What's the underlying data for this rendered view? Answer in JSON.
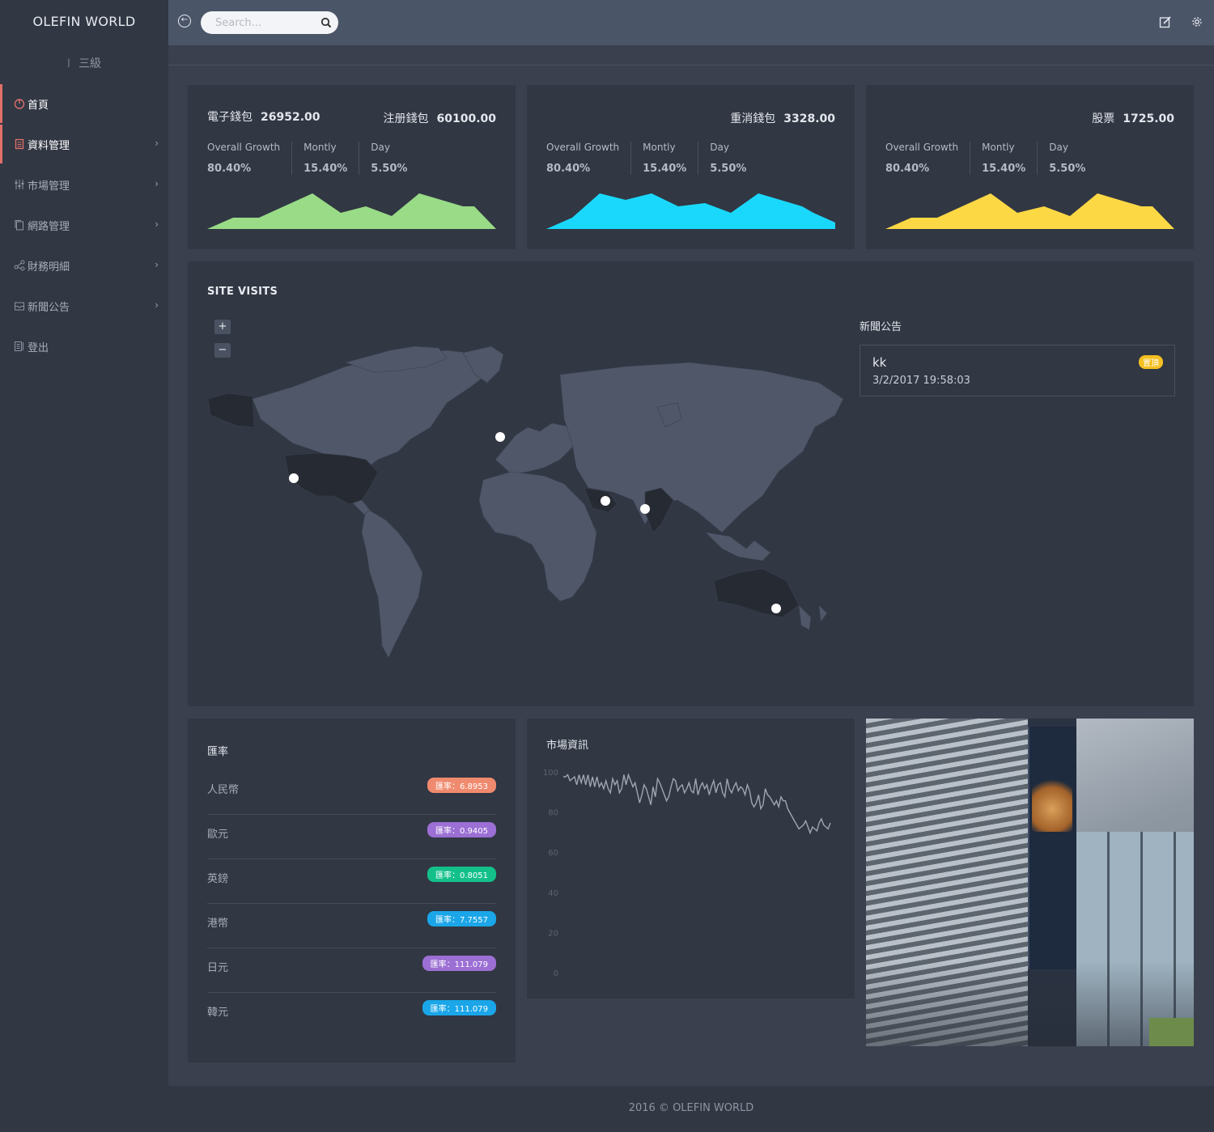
{
  "brand": "OLEFIN WORLD",
  "level": {
    "bar": "I",
    "label": "三級"
  },
  "sidebar": {
    "items": [
      {
        "label": "首頁",
        "icon": "power-icon"
      },
      {
        "label": "資料管理",
        "icon": "document-icon"
      },
      {
        "label": "市場管理",
        "icon": "sliders-icon"
      },
      {
        "label": "網路管理",
        "icon": "copy-icon"
      },
      {
        "label": "財務明細",
        "icon": "share-icon"
      },
      {
        "label": "新聞公告",
        "icon": "inbox-icon"
      },
      {
        "label": "登出",
        "icon": "list-icon"
      }
    ]
  },
  "topbar": {
    "search_placeholder": "Search...",
    "back_icon": "back-arrow-icon",
    "search_icon": "search-icon",
    "edit_icon": "edit-icon",
    "settings_icon": "gear-icon"
  },
  "stats": [
    {
      "items": [
        {
          "label": "電子錢包",
          "value": "26952.00"
        },
        {
          "label": "注册錢包",
          "value": "60100.00"
        }
      ],
      "metrics": [
        {
          "label": "Overall Growth",
          "value": "80.40%"
        },
        {
          "label": "Montly",
          "value": "15.40%"
        },
        {
          "label": "Day",
          "value": "5.50%"
        }
      ],
      "color": "#99db86"
    },
    {
      "items": [
        {
          "label": "重消錢包",
          "value": "3328.00"
        }
      ],
      "metrics": [
        {
          "label": "Overall Growth",
          "value": "80.40%"
        },
        {
          "label": "Montly",
          "value": "15.40%"
        },
        {
          "label": "Day",
          "value": "5.50%"
        }
      ],
      "color": "#1ad8fb"
    },
    {
      "items": [
        {
          "label": "股票",
          "value": "1725.00"
        }
      ],
      "metrics": [
        {
          "label": "Overall Growth",
          "value": "80.40%"
        },
        {
          "label": "Montly",
          "value": "15.40%"
        },
        {
          "label": "Day",
          "value": "5.50%"
        }
      ],
      "color": "#fdd845"
    }
  ],
  "visits": {
    "title": "SITE VISITS",
    "zoom_in": "+",
    "zoom_out": "−"
  },
  "news": {
    "title": "新聞公告",
    "items": [
      {
        "headline": "kk",
        "date": "3/2/2017 19:58:03",
        "badge": "置頂"
      }
    ]
  },
  "rates": {
    "title": "匯率",
    "items": [
      {
        "currency": "人民幣",
        "rate": "匯率：6.8953",
        "color": "#f08a6e"
      },
      {
        "currency": "歐元",
        "rate": "匯率：0.9405",
        "color": "#9b6fd4"
      },
      {
        "currency": "英鎊",
        "rate": "匯率：0.8051",
        "color": "#13c08a"
      },
      {
        "currency": "港幣",
        "rate": "匯率：7.7557",
        "color": "#1aa6e8"
      },
      {
        "currency": "日元",
        "rate": "匯率：111.079",
        "color": "#9b6fd4"
      },
      {
        "currency": "韓元",
        "rate": "匯率：111.079",
        "color": "#1aa6e8"
      }
    ]
  },
  "market": {
    "title": "市場資訊"
  },
  "chart_data": {
    "type": "line",
    "title": "",
    "xlabel": "",
    "ylabel": "",
    "yticks": [
      0,
      20,
      40,
      60,
      80,
      100
    ],
    "ylim": [
      0,
      100
    ],
    "x": [
      0,
      1,
      2,
      3,
      4,
      5,
      6,
      7,
      8,
      9,
      10,
      11,
      12,
      13,
      14,
      15,
      16,
      17,
      18,
      19,
      20,
      21,
      22,
      23,
      24,
      25,
      26,
      27,
      28,
      29,
      30,
      31,
      32,
      33,
      34,
      35,
      36,
      37,
      38,
      39,
      40,
      41,
      42,
      43,
      44,
      45,
      46,
      47,
      48,
      49,
      50,
      51,
      52,
      53,
      54,
      55,
      56,
      57,
      58,
      59,
      60,
      61,
      62,
      63,
      64,
      65,
      66,
      67,
      68,
      69,
      70,
      71,
      72,
      73,
      74,
      75,
      76,
      77,
      78,
      79,
      80,
      81,
      82,
      83,
      84,
      85,
      86,
      87,
      88,
      89,
      90,
      91,
      92,
      93,
      94,
      95,
      96,
      97,
      98,
      99,
      100,
      101,
      102,
      103,
      104,
      105,
      106,
      107,
      108,
      109,
      110,
      111,
      112,
      113,
      114,
      115,
      116,
      117,
      118,
      119
    ],
    "series": [
      {
        "values": [
          98,
          98,
          99,
          96,
          97,
          98,
          94,
          99,
          95,
          99,
          94,
          99,
          93,
          98,
          93,
          98,
          93,
          95,
          92,
          96,
          92,
          90,
          97,
          94,
          96,
          90,
          92,
          99,
          94,
          99,
          96,
          93,
          95,
          90,
          85,
          89,
          94,
          92,
          88,
          84,
          93,
          88,
          97,
          95,
          92,
          89,
          86,
          88,
          93,
          97,
          96,
          91,
          93,
          94,
          90,
          92,
          95,
          91,
          90,
          97,
          89,
          93,
          95,
          92,
          94,
          89,
          93,
          96,
          90,
          94,
          95,
          90,
          88,
          97,
          92,
          90,
          93,
          95,
          91,
          93,
          92,
          89,
          94,
          91,
          85,
          83,
          85,
          89,
          82,
          84,
          92,
          89,
          88,
          86,
          84,
          86,
          83,
          88,
          86,
          86,
          82,
          80,
          78,
          76,
          74,
          72,
          73,
          74,
          76,
          73,
          70,
          73,
          72,
          71,
          75,
          77,
          74,
          73,
          72,
          75
        ]
      }
    ]
  }
}
